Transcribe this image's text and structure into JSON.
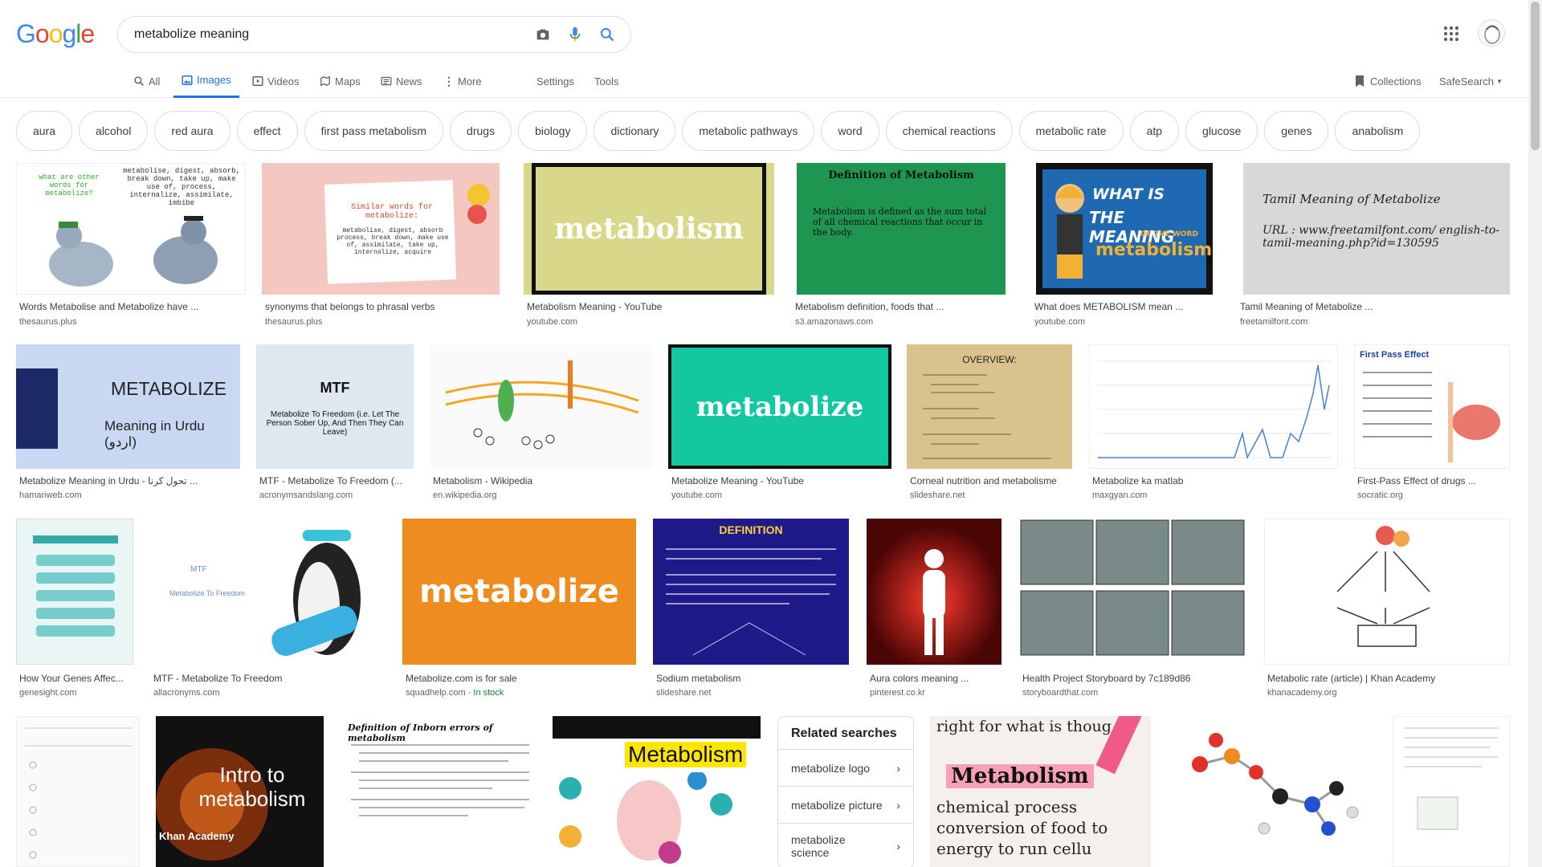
{
  "header": {
    "logo": [
      "G",
      "o",
      "o",
      "g",
      "l",
      "e"
    ],
    "logo_colors": [
      "#4285f4",
      "#ea4335",
      "#fbbc05",
      "#4285f4",
      "#34a853",
      "#ea4335"
    ],
    "query": "metabolize meaning"
  },
  "nav": {
    "all": "All",
    "images": "Images",
    "videos": "Videos",
    "maps": "Maps",
    "news": "News",
    "more": "More",
    "settings": "Settings",
    "tools": "Tools",
    "collections": "Collections",
    "safesearch": "SafeSearch"
  },
  "chips": [
    "aura",
    "alcohol",
    "red aura",
    "effect",
    "first pass metabolism",
    "drugs",
    "biology",
    "dictionary",
    "metabolic pathways",
    "word",
    "chemical reactions",
    "metabolic rate",
    "atp",
    "glucose",
    "genes",
    "anabolism"
  ],
  "results": [
    {
      "title": "Words Metabolise and Metabolize have ...",
      "source": "thesaurus.plus"
    },
    {
      "title": "synonyms that belongs to phrasal verbs",
      "source": "thesaurus.plus"
    },
    {
      "title": "Metabolism Meaning - YouTube",
      "source": "youtube.com"
    },
    {
      "title": "Metabolism definition, foods that ...",
      "source": "s3.amazonaws.com"
    },
    {
      "title": "What does METABOLISM mean ...",
      "source": "youtube.com"
    },
    {
      "title": "Tamil Meaning of Metabolize ...",
      "source": "freetamilfont.com"
    },
    {
      "title": "Metabolize Meaning in Urdu - تحول کرنا ...",
      "source": "hamariweb.com"
    },
    {
      "title": "MTF - Metabolize To Freedom (...",
      "source": "acronymsandslang.com"
    },
    {
      "title": "Metabolism - Wikipedia",
      "source": "en.wikipedia.org"
    },
    {
      "title": "Metabolize Meaning - YouTube",
      "source": "youtube.com"
    },
    {
      "title": "Corneal nutrition and metabolisme",
      "source": "slideshare.net"
    },
    {
      "title": "Metabolize ka matlab",
      "source": "maxgyan.com"
    },
    {
      "title": "First-Pass Effect of drugs ...",
      "source": "socratic.org"
    },
    {
      "title": "How Your Genes Affec...",
      "source": "genesight.com"
    },
    {
      "title": "MTF - Metabolize To Freedom",
      "source": "allacronyms.com"
    },
    {
      "title": "Metabolize.com is for sale",
      "source": "squadhelp.com",
      "extra": " · In stock"
    },
    {
      "title": "Sodium metabolism",
      "source": "slideshare.net"
    },
    {
      "title": "Aura colors meaning ...",
      "source": "pinterest.co.kr"
    },
    {
      "title": "Health Project Storyboard by 7c189d86",
      "source": "storyboardthat.com"
    },
    {
      "title": "Metabolic rate (article) | Khan Academy",
      "source": "khanacademy.org"
    }
  ],
  "thumb_text": {
    "t1a": "what are other words for metabolize?",
    "t1b": "metabolise, digest, absorb, break down, take up, make use of, process, internalize, assimilate, imbibe",
    "t2a": "Similar words for metabolize:",
    "t2b": "metabolise, digest, absorb process, break down, make use of, assimilate, take up, internalize, acquire",
    "t3": "metabolism",
    "t4a": "Definition of Metabolism",
    "t4b": "Metabolism is defined as the sum total of all chemical reactions that occur in the body.",
    "t5a": "WHAT IS",
    "t5b": "THE MEANING",
    "t5c": "OF THE WORD",
    "t5d": "metabolism",
    "t6a": "Tamil Meaning of Metabolize",
    "t6b": "URL : www.freetamilfont.com/ english-to-tamil-meaning.php?id=130595",
    "t7a": "METABOLIZE",
    "t7b": "Meaning in Urdu (اردو)",
    "t8a": "MTF",
    "t8b": "Metabolize To Freedom (i.e. Let The Person Sober Up, And Then They Can Leave)",
    "t10": "metabolize",
    "t11": "OVERVIEW:",
    "t13": "First Pass Effect",
    "t15a": "MTF",
    "t15b": "Metabolize To Freedom",
    "t16": "metabolize",
    "t17": "DEFINITION",
    "t21": "Intro to metabolism",
    "t21b": "Khan Academy",
    "t22": "Definition of Inborn errors of metabolism",
    "t23": "Metabolism",
    "t25a": "right for what is thoug",
    "t25b": "Metabolism",
    "t25c": "chemical process conversion of food to energy to run cellu"
  },
  "related": {
    "title": "Related searches",
    "items": [
      "metabolize logo",
      "metabolize picture",
      "metabolize science"
    ]
  }
}
